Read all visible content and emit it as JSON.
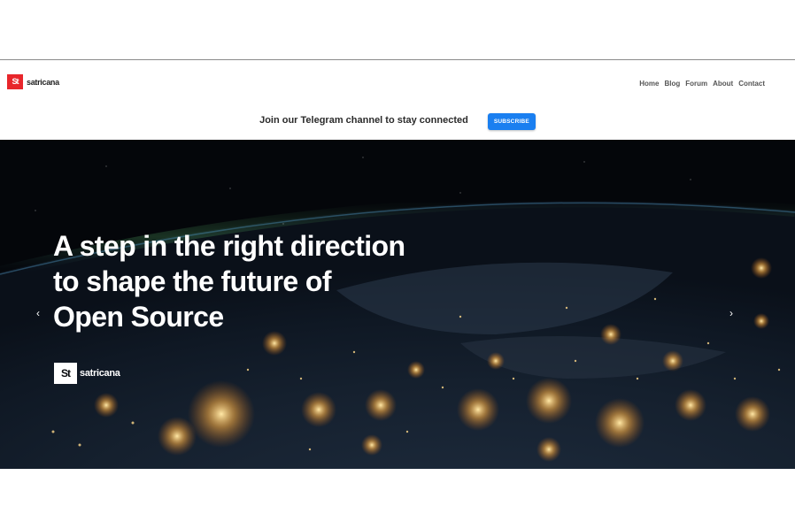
{
  "brand": {
    "name": "satricana",
    "mark": "St",
    "accent": "#e8262b"
  },
  "nav": {
    "items": [
      "Home",
      "Blog",
      "Forum",
      "About",
      "Contact"
    ]
  },
  "announce": {
    "text": "Join our Telegram channel to stay connected",
    "button_label": "SUBSCRIBE",
    "button_color": "#1a7ff0"
  },
  "hero": {
    "title_lines": [
      "A step in the right direction",
      "to shape the future of",
      "Open Source"
    ],
    "logo_name": "satricana",
    "logo_mark": "St",
    "prev_icon": "‹",
    "next_icon": "›"
  }
}
